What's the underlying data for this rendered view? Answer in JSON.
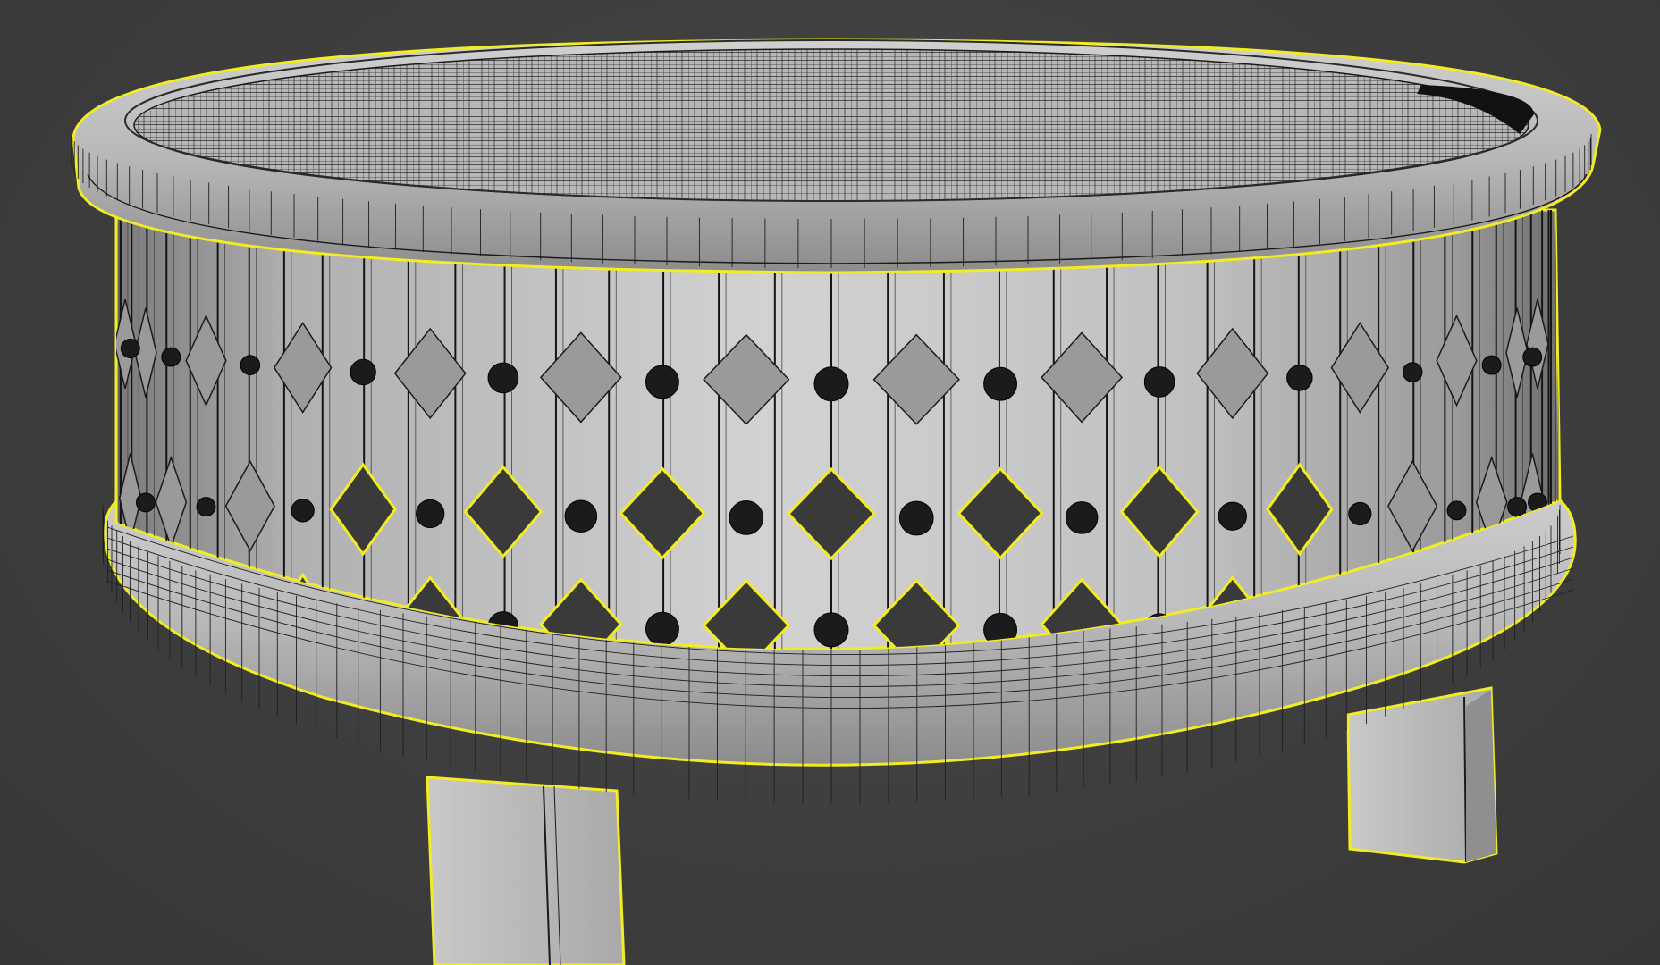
{
  "viewport": {
    "background_color": "#3f3f3f",
    "selection_outline_color": "#f2ec25",
    "model_surface_color": "#b9b9b9",
    "wire_color": "#161616"
  },
  "model": {
    "object": "round-coffee-table",
    "display_mode": "edged-faces",
    "selected": true,
    "parts": [
      "tabletop-rim",
      "tabletop-surface",
      "lattice-apron",
      "base-ring",
      "leg-front",
      "leg-right"
    ]
  }
}
